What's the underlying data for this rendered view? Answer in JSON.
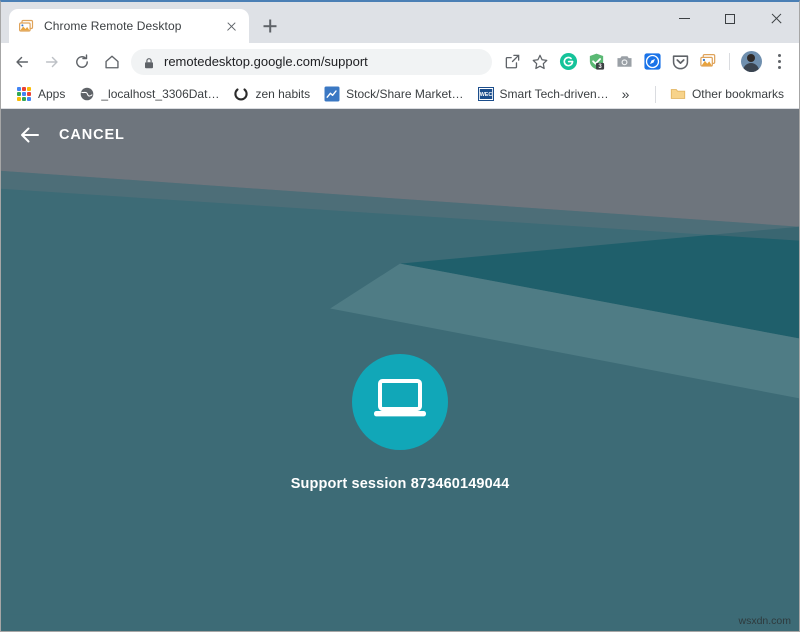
{
  "window": {
    "controls": {
      "minimize": "minimize-button",
      "maximize": "maximize-button",
      "close": "close-button"
    }
  },
  "tab": {
    "title": "Chrome Remote Desktop",
    "favicon": "chrome-remote-desktop-icon",
    "close_icon": "close-icon",
    "new_tab_icon": "plus-icon"
  },
  "toolbar": {
    "back_icon": "back-arrow-icon",
    "forward_icon": "forward-arrow-icon",
    "reload_icon": "reload-icon",
    "home_icon": "home-icon",
    "lock_icon": "lock-icon",
    "url_domain": "remotedesktop.google.com",
    "url_path": "/support",
    "url_full": "remotedesktop.google.com/support",
    "share_icon": "share-open-icon",
    "bookmark_icon": "star-icon",
    "extensions": [
      {
        "name": "grammarly-extension-icon",
        "glyph": "G",
        "color": "#15c39a",
        "badge": ""
      },
      {
        "name": "adblock-shield-extension-icon",
        "glyph": "✓",
        "color": "#5bb974",
        "badge": "3"
      },
      {
        "name": "screenshot-camera-extension-icon",
        "glyph": "camera",
        "color": "#9aa0a6",
        "badge": ""
      },
      {
        "name": "compass-extension-icon",
        "glyph": "compass",
        "color": "#1a73e8",
        "badge": ""
      },
      {
        "name": "pocket-extension-icon",
        "glyph": "chevron-shield",
        "color": "#5f6368",
        "badge": ""
      },
      {
        "name": "chrome-remote-desktop-extension-icon",
        "glyph": "remote-desktop",
        "color": "#e8a33d",
        "badge": ""
      }
    ],
    "avatar": "profile-avatar",
    "menu_icon": "three-dot-menu-icon"
  },
  "bookmarks": {
    "apps_label": "Apps",
    "items": [
      {
        "label": "_localhost_3306Dat…",
        "icon": "globe-icon",
        "color": "#5f6368"
      },
      {
        "label": "zen habits",
        "icon": "circle-outline-icon",
        "color": "#2b2b2b"
      },
      {
        "label": "Stock/Share Market…",
        "icon": "blue-square-icon",
        "color": "#3b78c3"
      },
      {
        "label": "Smart Tech-driven…",
        "icon": "wec-icon",
        "color": "#1c4e8c"
      }
    ],
    "overflow_label": "»",
    "other_bookmarks_label": "Other bookmarks",
    "other_bookmarks_icon": "folder-icon"
  },
  "page": {
    "appbar": {
      "back_icon": "back-arrow-icon",
      "cancel_label": "CANCEL"
    },
    "hero": {
      "icon": "laptop-icon",
      "circle_color": "#11a7b8",
      "session_label": "Support session 873460149044",
      "session_id": "873460149044"
    },
    "background": {
      "gray": "#6e757d",
      "teal_light": "#3d6b76",
      "teal_mid": "#4f7c85",
      "teal_dark": "#1f5f6b"
    },
    "watermark": "wsxdn.com"
  }
}
